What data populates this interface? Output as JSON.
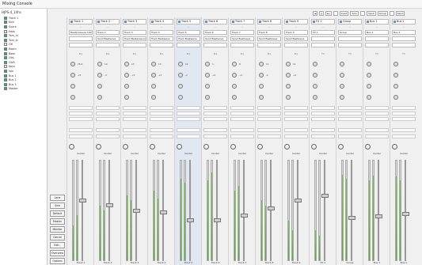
{
  "window": {
    "title": "Mixing Console"
  },
  "sidebar": {
    "header": "HJPS-4_14hs",
    "items": [
      {
        "label": "Track 1",
        "checked": true
      },
      {
        "label": "Kick",
        "checked": true
      },
      {
        "label": "Snare",
        "checked": true
      },
      {
        "label": "Hats",
        "checked": false
      },
      {
        "label": "Tom_hi",
        "checked": true
      },
      {
        "label": "Tom_lo",
        "checked": true
      },
      {
        "label": "OH",
        "checked": false
      },
      {
        "label": "Room",
        "checked": true
      },
      {
        "label": "Bass",
        "checked": true
      },
      {
        "label": "GtrL",
        "checked": true
      },
      {
        "label": "GtrR",
        "checked": true
      },
      {
        "label": "Keys",
        "checked": false
      },
      {
        "label": "Vox",
        "checked": true
      },
      {
        "label": "Bus 1",
        "checked": true
      },
      {
        "label": "Bus 2",
        "checked": true
      },
      {
        "label": "Bus 3",
        "checked": true
      },
      {
        "label": "Master",
        "checked": true
      }
    ],
    "buttons": [
      "Lane",
      "Solo",
      "Default",
      "Master",
      "Monitor",
      "Cancel",
      "Edit..",
      "Overview",
      "Options"
    ]
  },
  "toolbar": {
    "items": [
      "◄",
      "||",
      "►|",
      "",
      "Input",
      "Solo",
      "",
      "Input",
      "Group",
      "",
      "Send"
    ]
  },
  "strips": [
    {
      "name": "Track 1",
      "sub": "—",
      "field1": "Beatpressure 140",
      "field2": "",
      "ins": "Pre",
      "knob1": "25.0",
      "knob2": "+5",
      "pan": "Center",
      "m1": 0.35,
      "m2": 0.45,
      "fader": 0.6,
      "foot": "Track 1"
    },
    {
      "name": "Track 2",
      "sub": "—",
      "field1": "Track 2",
      "field2": "Send Beatwave",
      "ins": "Pre",
      "knob1": "10",
      "knob2": "-3",
      "pan": "Center",
      "m1": 0.55,
      "m2": 0.5,
      "fader": 0.55,
      "foot": "Track 2"
    },
    {
      "name": "Track 3",
      "sub": "—",
      "field1": "Track 3",
      "field2": "Track Beatpressure",
      "ins": "Pre",
      "knob1": "13",
      "knob2": "+3",
      "pan": "Center",
      "m1": 0.65,
      "m2": 0.6,
      "fader": 0.5,
      "foot": "Track 3"
    },
    {
      "name": "Track 4",
      "sub": "—",
      "field1": "Track 4",
      "field2": "Track Beatwave",
      "ins": "Pre",
      "knob1": "13",
      "knob2": "+2",
      "pan": "Center",
      "m1": 0.7,
      "m2": 0.62,
      "fader": 0.48,
      "foot": "Track 4"
    },
    {
      "name": "Track 5",
      "sub": "—",
      "field1": "Track 5",
      "field2": "Track Beatwave",
      "ins": "Pre",
      "knob1": "12",
      "knob2": "-2",
      "pan": "Center",
      "m1": 0.82,
      "m2": 0.78,
      "fader": 0.4,
      "foot": "Track 5"
    },
    {
      "name": "Track 6",
      "sub": "—",
      "field1": "Track 6",
      "field2": "Send Beatwave",
      "ins": "Pre",
      "knob1": "1:",
      "knob2": "+4",
      "pan": "Center",
      "m1": 0.8,
      "m2": 0.88,
      "fader": 0.4,
      "foot": "Track 6"
    },
    {
      "name": "Track 7",
      "sub": "—",
      "field1": "Track 7",
      "field2": "Send Beatwave",
      "ins": "Pre",
      "knob1": "8",
      "knob2": "+1",
      "pan": "Center",
      "m1": 0.7,
      "m2": 0.75,
      "fader": 0.45,
      "foot": "Track 7"
    },
    {
      "name": "Track 8",
      "sub": "—",
      "field1": "Track 8",
      "field2": "Send Beatwave",
      "ins": "Pre",
      "knob1": "11",
      "knob2": "-1",
      "pan": "Center",
      "m1": 0.6,
      "m2": 0.55,
      "fader": 0.52,
      "foot": "Track 8"
    },
    {
      "name": "Track 9",
      "sub": "—",
      "field1": "Track 9",
      "field2": "Send Beatwave",
      "ins": "Pre",
      "knob1": "11",
      "knob2": "+2",
      "pan": "Center",
      "m1": 0.4,
      "m2": 0.3,
      "fader": 0.6,
      "foot": "Track 9"
    },
    {
      "name": "FX 1",
      "sub": "—",
      "field1": "FX 1",
      "field2": "",
      "ins": "FX",
      "knob1": "",
      "knob2": "",
      "pan": "Center",
      "m1": 0.3,
      "m2": 0.25,
      "fader": 0.65,
      "foot": "FX 1"
    },
    {
      "name": "Group",
      "sub": "—",
      "field1": "Group",
      "field2": "",
      "ins": "FX",
      "knob1": "",
      "knob2": "",
      "pan": "Center",
      "m1": 0.86,
      "m2": 0.82,
      "fader": 0.42,
      "foot": "Group"
    },
    {
      "name": "Bus 1",
      "sub": "—",
      "field1": "Bus 1",
      "field2": "",
      "ins": "FX",
      "knob1": "",
      "knob2": "",
      "pan": "Center",
      "m1": 0.8,
      "m2": 0.85,
      "fader": 0.44,
      "foot": "Bus 1"
    },
    {
      "name": "Bus 2",
      "sub": "—",
      "field1": "Bus 2",
      "field2": "",
      "ins": "FX",
      "knob1": "",
      "knob2": "",
      "pan": "Center",
      "m1": 0.84,
      "m2": 0.8,
      "fader": 0.46,
      "foot": "Bus 2"
    }
  ]
}
